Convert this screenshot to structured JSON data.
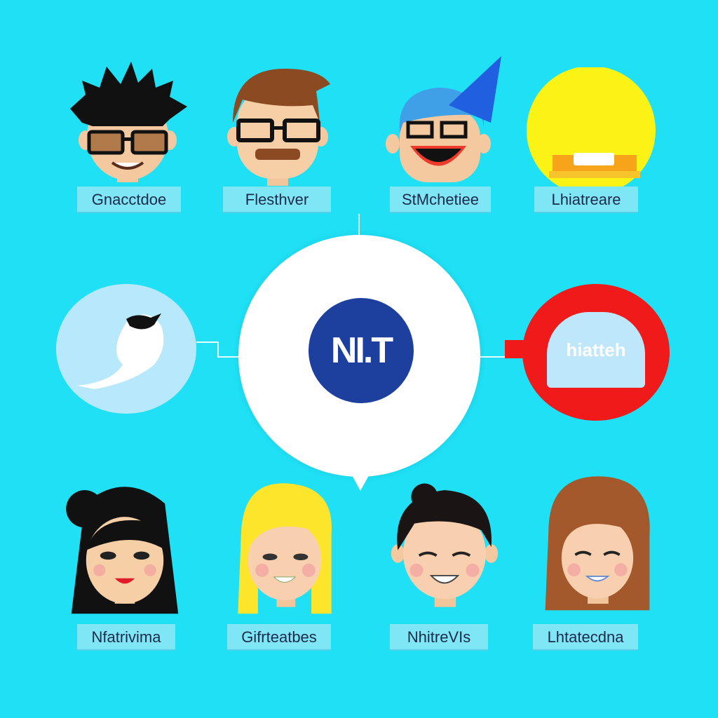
{
  "people_top": [
    {
      "name": "Gnacctdoe",
      "icon": "spiky-hair-glasses-man-icon"
    },
    {
      "name": "Flesthver",
      "icon": "brown-hair-glasses-mustache-man-icon"
    },
    {
      "name": "StMchetiee",
      "icon": "blue-hair-party-hat-man-icon"
    },
    {
      "name": "Lhiatreare",
      "icon": "yellow-circle-icon"
    }
  ],
  "people_bottom": [
    {
      "name": "Nfatrivima",
      "icon": "black-hair-woman-icon"
    },
    {
      "name": "Gifrteatbes",
      "icon": "blonde-woman-icon"
    },
    {
      "name": "NhitreVIs",
      "icon": "dark-hair-man-icon"
    },
    {
      "name": "Lhtatecdna",
      "icon": "brown-hair-woman-icon"
    }
  ],
  "hub": {
    "logo_text": "NI.T"
  },
  "side_right": {
    "label": "hiatteh"
  },
  "colors": {
    "background": "#1fe0f5",
    "hub_logo": "#1d3f9e",
    "accent_red": "#f01a1a",
    "label_bg": "#7fe6f6"
  }
}
